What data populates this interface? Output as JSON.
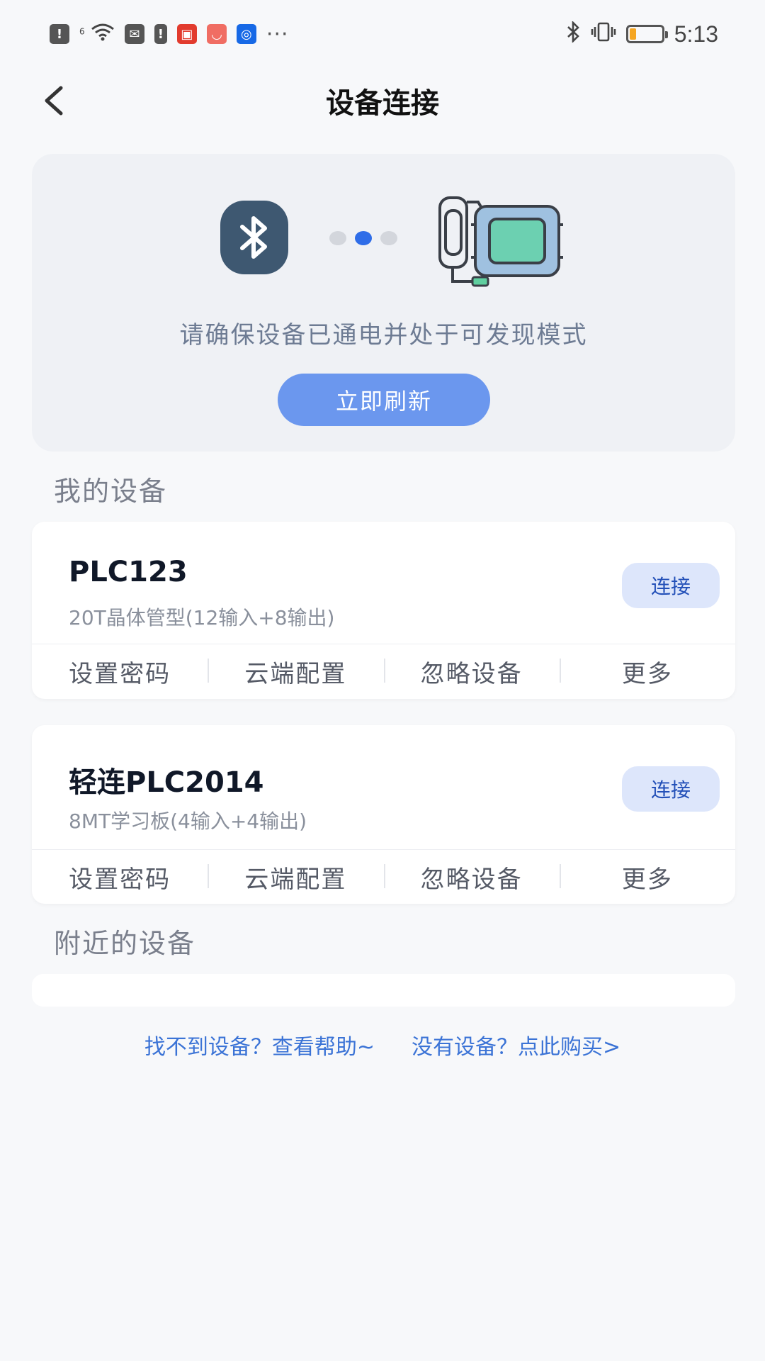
{
  "status_bar": {
    "time": "5:13",
    "wifi_label": "6",
    "more": "···",
    "battery_level": 0.2,
    "notification_icons": [
      "alert-icon",
      "wifi-icon",
      "mail-icon",
      "sim-alert-icon",
      "red-app-icon",
      "shopping-app-icon",
      "blue-app-icon"
    ]
  },
  "nav": {
    "title": "设备连接"
  },
  "hero": {
    "hint": "请确保设备已通电并处于可发现模式",
    "refresh_label": "立即刷新",
    "accent_color": "#6b97ee"
  },
  "my_devices": {
    "title": "我的设备",
    "items": [
      {
        "name": "PLC123",
        "desc": "20T晶体管型(12输入+8输出)",
        "connect_label": "连接",
        "actions": [
          "设置密码",
          "云端配置",
          "忽略设备",
          "更多"
        ]
      },
      {
        "name": "轻连PLC2014",
        "desc": "8MT学习板(4输入+4输出)",
        "connect_label": "连接",
        "actions": [
          "设置密码",
          "云端配置",
          "忽略设备",
          "更多"
        ]
      }
    ]
  },
  "nearby": {
    "title": "附近的设备"
  },
  "footer": {
    "help_link": "找不到设备？查看帮助~",
    "buy_link": "没有设备？点此购买>"
  }
}
